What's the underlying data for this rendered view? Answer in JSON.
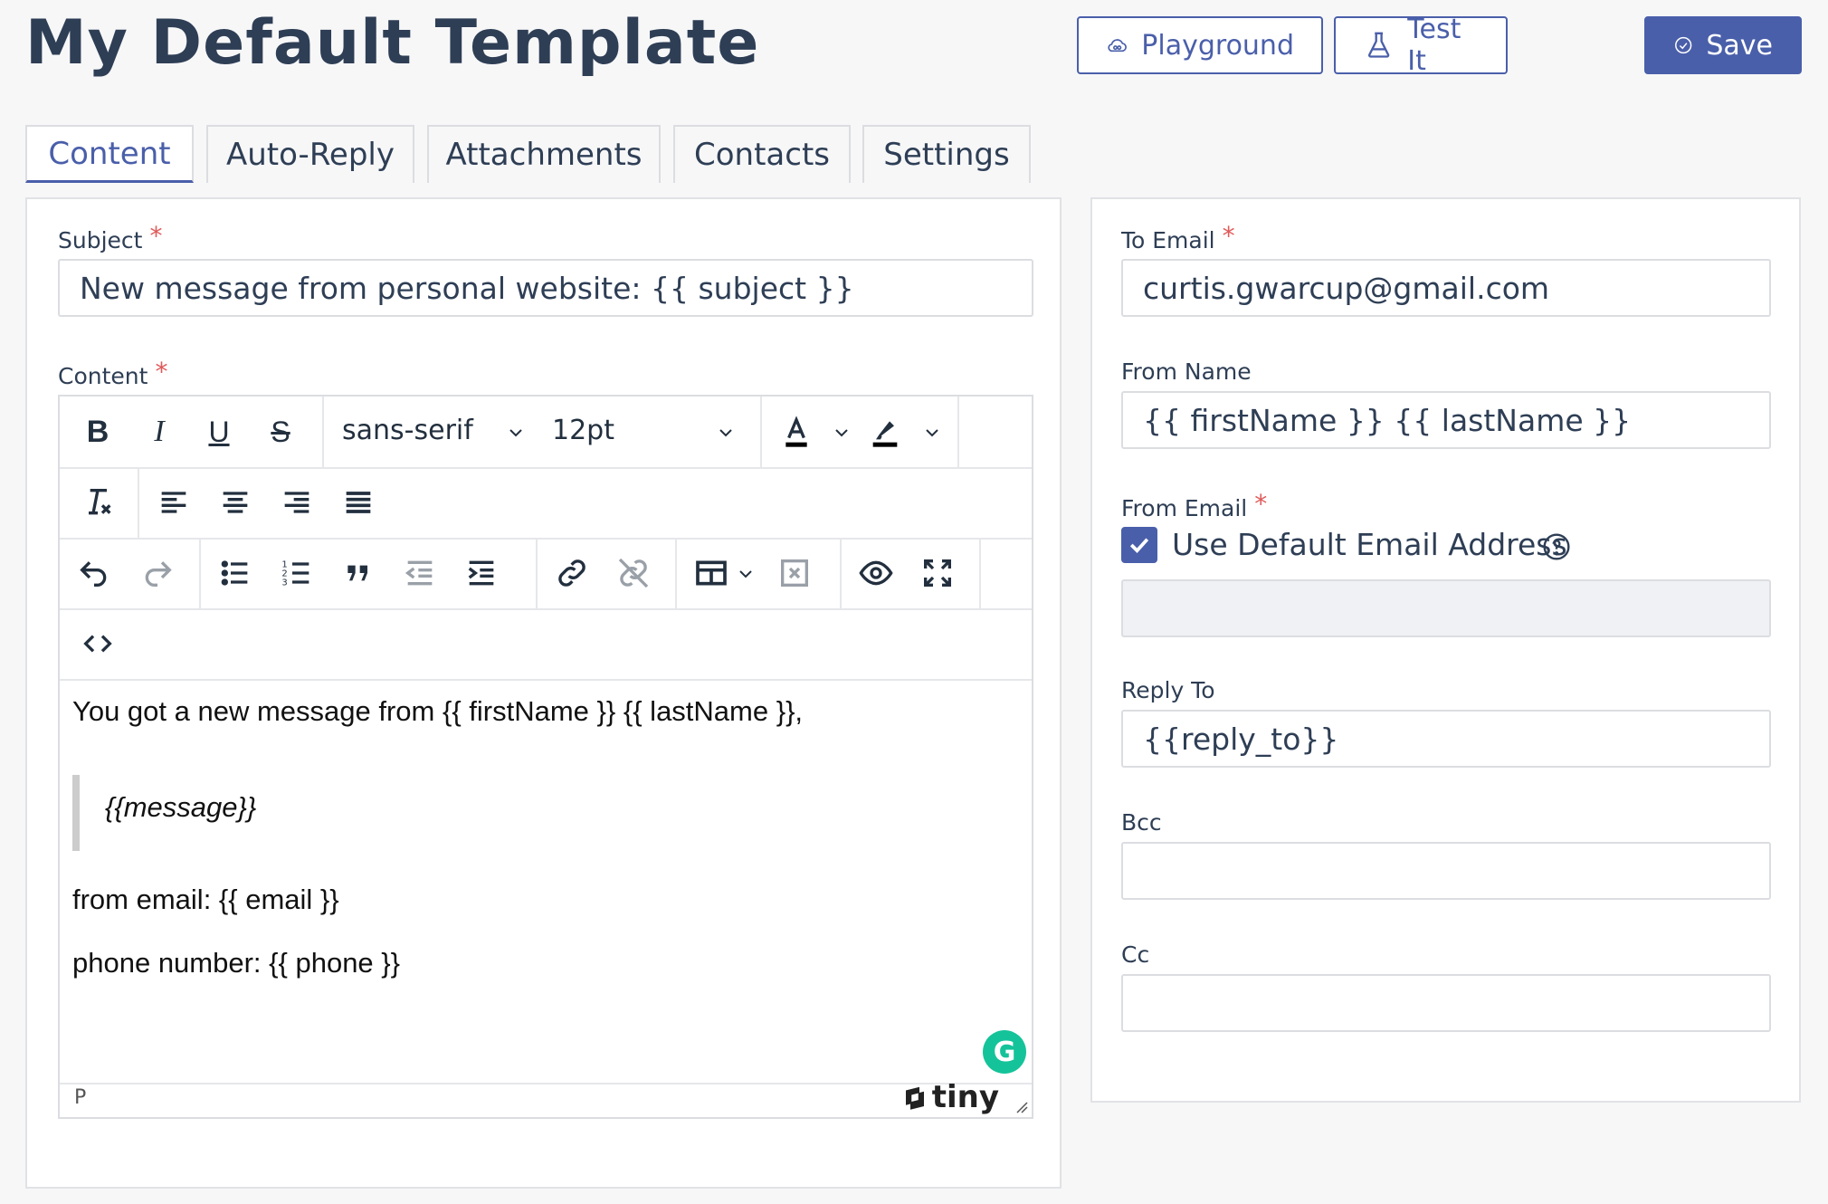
{
  "header": {
    "title": "My Default Template",
    "playground_label": "Playground",
    "testit_label": "Test It",
    "save_label": "Save"
  },
  "tabs": [
    {
      "label": "Content",
      "active": true
    },
    {
      "label": "Auto-Reply"
    },
    {
      "label": "Attachments"
    },
    {
      "label": "Contacts"
    },
    {
      "label": "Settings"
    }
  ],
  "left": {
    "subject_label": "Subject",
    "subject_value": "New message from personal website: {{ subject }}",
    "content_label": "Content",
    "required_mark": "*"
  },
  "editor": {
    "font_family": "sans-serif",
    "font_size": "12pt",
    "lines": {
      "line1": "You got a new message from {{ firstName }} {{ lastName }},",
      "quote": "{{message}}",
      "line2": "from email: {{ email }}",
      "line3": "phone number: {{ phone }}"
    },
    "status_path": "P",
    "brand": "tiny"
  },
  "right": {
    "to_email_label": "To Email",
    "to_email_value": "curtis.gwarcup@gmail.com",
    "from_name_label": "From Name",
    "from_name_value": "{{ firstName }} {{ lastName }}",
    "from_email_label": "From Email",
    "use_default_label": "Use Default Email Address",
    "use_default_checked": true,
    "from_email_value": "",
    "reply_to_label": "Reply To",
    "reply_to_value": "{{reply_to}}",
    "bcc_label": "Bcc",
    "bcc_value": "",
    "cc_label": "Cc",
    "cc_value": ""
  },
  "colors": {
    "accent": "#4a5faa",
    "required": "#e05a5a",
    "grammarly": "#15c39a"
  }
}
